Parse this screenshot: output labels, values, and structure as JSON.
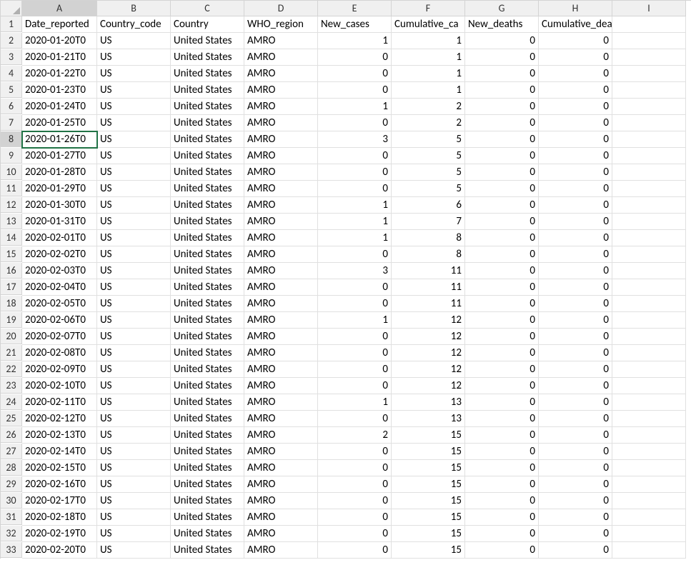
{
  "columns": [
    "A",
    "B",
    "C",
    "D",
    "E",
    "F",
    "G",
    "H",
    "I"
  ],
  "headers": [
    "Date_reported",
    "Country_code",
    "Country",
    "WHO_region",
    "New_cases",
    "Cumulative_cases",
    "New_deaths",
    "Cumulative_deaths",
    ""
  ],
  "header_display": [
    "Date_reported",
    "Country_code",
    "Country",
    "WHO_region",
    "New_cases",
    "Cumulative_ca",
    "New_deaths",
    "Cumulative_deaths",
    ""
  ],
  "active_cell": {
    "row": 8,
    "col": "A"
  },
  "rows": [
    {
      "n": 2,
      "date": "2020-01-20T0",
      "cc": "US",
      "country": "United States",
      "region": "AMRO",
      "nc": 1,
      "cum_c": 1,
      "nd": 0,
      "cum_d": 0
    },
    {
      "n": 3,
      "date": "2020-01-21T0",
      "cc": "US",
      "country": "United States",
      "region": "AMRO",
      "nc": 0,
      "cum_c": 1,
      "nd": 0,
      "cum_d": 0
    },
    {
      "n": 4,
      "date": "2020-01-22T0",
      "cc": "US",
      "country": "United States",
      "region": "AMRO",
      "nc": 0,
      "cum_c": 1,
      "nd": 0,
      "cum_d": 0
    },
    {
      "n": 5,
      "date": "2020-01-23T0",
      "cc": "US",
      "country": "United States",
      "region": "AMRO",
      "nc": 0,
      "cum_c": 1,
      "nd": 0,
      "cum_d": 0
    },
    {
      "n": 6,
      "date": "2020-01-24T0",
      "cc": "US",
      "country": "United States",
      "region": "AMRO",
      "nc": 1,
      "cum_c": 2,
      "nd": 0,
      "cum_d": 0
    },
    {
      "n": 7,
      "date": "2020-01-25T0",
      "cc": "US",
      "country": "United States",
      "region": "AMRO",
      "nc": 0,
      "cum_c": 2,
      "nd": 0,
      "cum_d": 0
    },
    {
      "n": 8,
      "date": "2020-01-26T0",
      "cc": "US",
      "country": "United States",
      "region": "AMRO",
      "nc": 3,
      "cum_c": 5,
      "nd": 0,
      "cum_d": 0
    },
    {
      "n": 9,
      "date": "2020-01-27T0",
      "cc": "US",
      "country": "United States",
      "region": "AMRO",
      "nc": 0,
      "cum_c": 5,
      "nd": 0,
      "cum_d": 0
    },
    {
      "n": 10,
      "date": "2020-01-28T0",
      "cc": "US",
      "country": "United States",
      "region": "AMRO",
      "nc": 0,
      "cum_c": 5,
      "nd": 0,
      "cum_d": 0
    },
    {
      "n": 11,
      "date": "2020-01-29T0",
      "cc": "US",
      "country": "United States",
      "region": "AMRO",
      "nc": 0,
      "cum_c": 5,
      "nd": 0,
      "cum_d": 0
    },
    {
      "n": 12,
      "date": "2020-01-30T0",
      "cc": "US",
      "country": "United States",
      "region": "AMRO",
      "nc": 1,
      "cum_c": 6,
      "nd": 0,
      "cum_d": 0
    },
    {
      "n": 13,
      "date": "2020-01-31T0",
      "cc": "US",
      "country": "United States",
      "region": "AMRO",
      "nc": 1,
      "cum_c": 7,
      "nd": 0,
      "cum_d": 0
    },
    {
      "n": 14,
      "date": "2020-02-01T0",
      "cc": "US",
      "country": "United States",
      "region": "AMRO",
      "nc": 1,
      "cum_c": 8,
      "nd": 0,
      "cum_d": 0
    },
    {
      "n": 15,
      "date": "2020-02-02T0",
      "cc": "US",
      "country": "United States",
      "region": "AMRO",
      "nc": 0,
      "cum_c": 8,
      "nd": 0,
      "cum_d": 0
    },
    {
      "n": 16,
      "date": "2020-02-03T0",
      "cc": "US",
      "country": "United States",
      "region": "AMRO",
      "nc": 3,
      "cum_c": 11,
      "nd": 0,
      "cum_d": 0
    },
    {
      "n": 17,
      "date": "2020-02-04T0",
      "cc": "US",
      "country": "United States",
      "region": "AMRO",
      "nc": 0,
      "cum_c": 11,
      "nd": 0,
      "cum_d": 0
    },
    {
      "n": 18,
      "date": "2020-02-05T0",
      "cc": "US",
      "country": "United States",
      "region": "AMRO",
      "nc": 0,
      "cum_c": 11,
      "nd": 0,
      "cum_d": 0
    },
    {
      "n": 19,
      "date": "2020-02-06T0",
      "cc": "US",
      "country": "United States",
      "region": "AMRO",
      "nc": 1,
      "cum_c": 12,
      "nd": 0,
      "cum_d": 0
    },
    {
      "n": 20,
      "date": "2020-02-07T0",
      "cc": "US",
      "country": "United States",
      "region": "AMRO",
      "nc": 0,
      "cum_c": 12,
      "nd": 0,
      "cum_d": 0
    },
    {
      "n": 21,
      "date": "2020-02-08T0",
      "cc": "US",
      "country": "United States",
      "region": "AMRO",
      "nc": 0,
      "cum_c": 12,
      "nd": 0,
      "cum_d": 0
    },
    {
      "n": 22,
      "date": "2020-02-09T0",
      "cc": "US",
      "country": "United States",
      "region": "AMRO",
      "nc": 0,
      "cum_c": 12,
      "nd": 0,
      "cum_d": 0
    },
    {
      "n": 23,
      "date": "2020-02-10T0",
      "cc": "US",
      "country": "United States",
      "region": "AMRO",
      "nc": 0,
      "cum_c": 12,
      "nd": 0,
      "cum_d": 0
    },
    {
      "n": 24,
      "date": "2020-02-11T0",
      "cc": "US",
      "country": "United States",
      "region": "AMRO",
      "nc": 1,
      "cum_c": 13,
      "nd": 0,
      "cum_d": 0
    },
    {
      "n": 25,
      "date": "2020-02-12T0",
      "cc": "US",
      "country": "United States",
      "region": "AMRO",
      "nc": 0,
      "cum_c": 13,
      "nd": 0,
      "cum_d": 0
    },
    {
      "n": 26,
      "date": "2020-02-13T0",
      "cc": "US",
      "country": "United States",
      "region": "AMRO",
      "nc": 2,
      "cum_c": 15,
      "nd": 0,
      "cum_d": 0
    },
    {
      "n": 27,
      "date": "2020-02-14T0",
      "cc": "US",
      "country": "United States",
      "region": "AMRO",
      "nc": 0,
      "cum_c": 15,
      "nd": 0,
      "cum_d": 0
    },
    {
      "n": 28,
      "date": "2020-02-15T0",
      "cc": "US",
      "country": "United States",
      "region": "AMRO",
      "nc": 0,
      "cum_c": 15,
      "nd": 0,
      "cum_d": 0
    },
    {
      "n": 29,
      "date": "2020-02-16T0",
      "cc": "US",
      "country": "United States",
      "region": "AMRO",
      "nc": 0,
      "cum_c": 15,
      "nd": 0,
      "cum_d": 0
    },
    {
      "n": 30,
      "date": "2020-02-17T0",
      "cc": "US",
      "country": "United States",
      "region": "AMRO",
      "nc": 0,
      "cum_c": 15,
      "nd": 0,
      "cum_d": 0
    },
    {
      "n": 31,
      "date": "2020-02-18T0",
      "cc": "US",
      "country": "United States",
      "region": "AMRO",
      "nc": 0,
      "cum_c": 15,
      "nd": 0,
      "cum_d": 0
    },
    {
      "n": 32,
      "date": "2020-02-19T0",
      "cc": "US",
      "country": "United States",
      "region": "AMRO",
      "nc": 0,
      "cum_c": 15,
      "nd": 0,
      "cum_d": 0
    },
    {
      "n": 33,
      "date": "2020-02-20T0",
      "cc": "US",
      "country": "United States",
      "region": "AMRO",
      "nc": 0,
      "cum_c": 15,
      "nd": 0,
      "cum_d": 0
    }
  ]
}
